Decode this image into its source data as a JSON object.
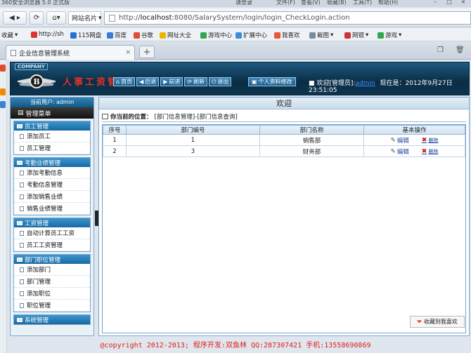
{
  "browser": {
    "title": "360安全浏览器 5.0 正式版",
    "login_link": "请登录",
    "menus": [
      "文件(F)",
      "查看(V)",
      "收藏(B)",
      "工具(T)",
      "帮助(H)"
    ],
    "site_name": "网站名片",
    "address_prefix": "http://",
    "address_host": "localhost",
    "address_rest": ":8080/SalarySystem/login/login_CheckLogin.action",
    "favorites": [
      {
        "label": "收藏",
        "icon": "star-icon"
      },
      {
        "label": "http://sh",
        "icon": "page-icon"
      },
      {
        "label": "115网盘",
        "icon": "disk-icon"
      },
      {
        "label": "百度",
        "icon": "baidu-icon"
      },
      {
        "label": "谷歌",
        "icon": "google-icon"
      },
      {
        "label": "网址大全",
        "icon": "url-icon"
      },
      {
        "label": "游戏中心",
        "icon": "game-icon"
      },
      {
        "label": "扩展中心",
        "icon": "extension-icon"
      },
      {
        "label": "我喜欢",
        "icon": "heart-icon"
      },
      {
        "label": "截图",
        "icon": "screenshot-icon"
      },
      {
        "label": "网银",
        "icon": "bank-icon"
      },
      {
        "label": "游戏",
        "icon": "gamepad-icon"
      }
    ],
    "tab_title": "企业信息管理系统",
    "tab_close": "×",
    "new_tab": "+"
  },
  "app": {
    "company": "COMPANY",
    "system_title": "人事工资管理",
    "toolbar": [
      {
        "label": "首页",
        "icon": "home-icon"
      },
      {
        "label": "后退",
        "icon": "back-icon"
      },
      {
        "label": "前进",
        "icon": "forward-icon"
      },
      {
        "label": "刷新",
        "icon": "refresh-icon"
      },
      {
        "label": "退出",
        "icon": "exit-icon"
      }
    ],
    "profile_button": "个人资料修改",
    "welcome_prefix": "欢迎[管理员]:",
    "welcome_user": "admin",
    "welcome_time": "现在是：2012年9月27日 23:51:05"
  },
  "sidebar": {
    "current_user": "当前用户: admin",
    "menu_title": "管理菜单",
    "sections": [
      {
        "title": "员工管理",
        "items": [
          "添加员工",
          "员工管理"
        ]
      },
      {
        "title": "考勤业绩管理",
        "items": [
          "添加考勤信息",
          "考勤信息管理",
          "添加销售业绩",
          "销售业绩管理"
        ]
      },
      {
        "title": "工资管理",
        "items": [
          "自动计算员工工资",
          "员工工资管理"
        ]
      },
      {
        "title": "部门职位管理",
        "items": [
          "添加部门",
          "部门管理",
          "添加职位",
          "职位管理"
        ]
      },
      {
        "title": "系统管理",
        "items": []
      }
    ]
  },
  "main": {
    "title": "欢迎",
    "position_label": "你当前的位置：",
    "position_path": "[部门信息管理]-[部门信息查询]",
    "columns": [
      "序号",
      "部门编号",
      "部门名称",
      "基本操作"
    ],
    "rows": [
      {
        "index": "1",
        "dept_no": "1",
        "dept_name": "销售部",
        "edit": "编辑",
        "delete": "删除"
      },
      {
        "index": "2",
        "dept_no": "3",
        "dept_name": "财务部",
        "edit": "编辑",
        "delete": "删除"
      }
    ],
    "favorite_button": "收藏到我喜欢"
  },
  "footer": "@copyright 2012-2013;  程序开发:双鱼林  QQ:287307421  手机:13558690869"
}
